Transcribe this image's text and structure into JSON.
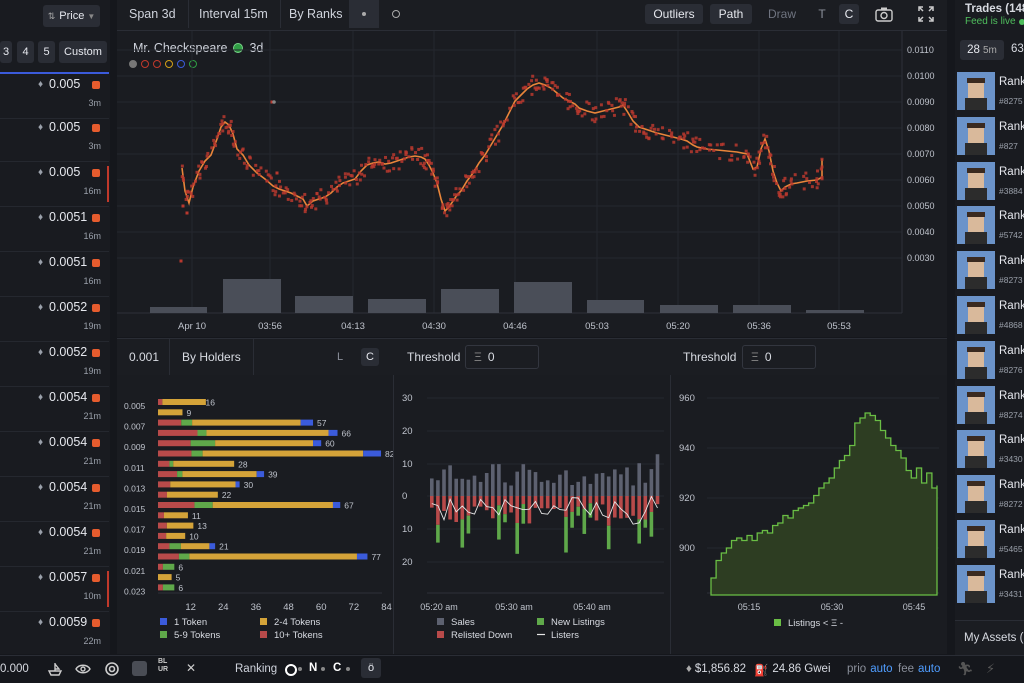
{
  "left_sidebar": {
    "sort_label": "Price",
    "qty_buttons": [
      "3",
      "4",
      "5",
      "Custom"
    ],
    "listings": [
      {
        "price": "0.005",
        "time": "3m",
        "marker": false
      },
      {
        "price": "0.005",
        "time": "3m",
        "marker": false
      },
      {
        "price": "0.005",
        "time": "16m",
        "marker": true
      },
      {
        "price": "0.0051",
        "time": "16m",
        "marker": false
      },
      {
        "price": "0.0051",
        "time": "16m",
        "marker": false
      },
      {
        "price": "0.0052",
        "time": "19m",
        "marker": false
      },
      {
        "price": "0.0052",
        "time": "19m",
        "marker": false
      },
      {
        "price": "0.0054",
        "time": "21m",
        "marker": false
      },
      {
        "price": "0.0054",
        "time": "21m",
        "marker": false
      },
      {
        "price": "0.0054",
        "time": "21m",
        "marker": false
      },
      {
        "price": "0.0054",
        "time": "21m",
        "marker": false
      },
      {
        "price": "0.0057",
        "time": "10m",
        "marker": true
      },
      {
        "price": "0.0059",
        "time": "22m",
        "marker": false
      }
    ]
  },
  "toolbar": {
    "span": "Span 3d",
    "interval": "Interval 15m",
    "by_ranks": "By Ranks",
    "outliers": "Outliers",
    "path": "Path",
    "draw": "Draw",
    "t": "T",
    "c": "C"
  },
  "main_chart": {
    "collection": "Mr. Checkspeare",
    "span_tag": "3d",
    "x_ticks": [
      "Apr 10",
      "03:56",
      "04:13",
      "04:30",
      "04:46",
      "05:03",
      "05:20",
      "05:36",
      "05:53"
    ],
    "y_ticks": [
      "0.0110",
      "0.0100",
      "0.0090",
      "0.0080",
      "0.0070",
      "0.0060",
      "0.0050",
      "0.0040",
      "0.0030"
    ],
    "legend_dot_colors": [
      "#777777",
      "#c0392b",
      "#c0392b",
      "#d4a017",
      "#3b5bdb",
      "#2f9e44"
    ]
  },
  "holders_panel": {
    "value": "0.001",
    "label": "By Holders",
    "l_btn": "L",
    "c_btn": "C",
    "chart_data": {
      "type": "bar",
      "orientation": "horizontal",
      "y_ticks": [
        "0.005",
        "0.007",
        "0.009",
        "0.011",
        "0.013",
        "0.015",
        "0.017",
        "0.019",
        "0.021",
        "0.023"
      ],
      "x_ticks": [
        "12",
        "24",
        "36",
        "48",
        "60",
        "72",
        "84"
      ],
      "rows": [
        {
          "price": 0.005,
          "total": 16
        },
        {
          "price": 0.006,
          "total": 9
        },
        {
          "price": 0.007,
          "total": 57
        },
        {
          "price": 0.008,
          "total": 66
        },
        {
          "price": 0.009,
          "total": 60
        },
        {
          "price": 0.01,
          "total": 82
        },
        {
          "price": 0.011,
          "total": 28
        },
        {
          "price": 0.012,
          "total": 39
        },
        {
          "price": 0.013,
          "total": 30
        },
        {
          "price": 0.014,
          "total": 22
        },
        {
          "price": 0.015,
          "total": 67
        },
        {
          "price": 0.016,
          "total": 11
        },
        {
          "price": 0.017,
          "total": 13
        },
        {
          "price": 0.018,
          "total": 10
        },
        {
          "price": 0.019,
          "total": 21
        },
        {
          "price": 0.02,
          "total": 77
        },
        {
          "price": 0.021,
          "total": 6
        },
        {
          "price": 0.022,
          "total": 5
        },
        {
          "price": 0.023,
          "total": 6
        }
      ],
      "legend": [
        "1 Token",
        "2-4 Tokens",
        "5-9 Tokens",
        "10+ Tokens"
      ],
      "colors": {
        "1 Token": "#3b5bdb",
        "2-4 Tokens": "#d4a339",
        "5-9 Tokens": "#5fa84a",
        "10+ Tokens": "#b84a4a"
      }
    }
  },
  "sales_panel": {
    "threshold_label": "Threshold",
    "threshold_value": "0",
    "chart_data": {
      "type": "bar",
      "y_ticks": [
        "30",
        "20",
        "10",
        "0",
        "10",
        "20"
      ],
      "x_ticks": [
        "05:20 am",
        "05:30 am",
        "05:40 am"
      ],
      "legend": [
        "Sales",
        "Relisted Down",
        "New Listings",
        "Listers"
      ],
      "colors": {
        "Sales": "#5d6170",
        "Relisted Down": "#b84a4a",
        "New Listings": "#5fa84a",
        "Listers": "#e0e0e0"
      }
    }
  },
  "listings_panel": {
    "threshold_label": "Threshold",
    "threshold_value": "0",
    "chart_data": {
      "type": "area",
      "y_ticks": [
        "960",
        "940",
        "920",
        "900"
      ],
      "x_ticks": [
        "05:15",
        "05:30",
        "05:45"
      ],
      "values": [
        888,
        895,
        898,
        900,
        903,
        904,
        903,
        905,
        903,
        906,
        907,
        906,
        909,
        910,
        913,
        912,
        915,
        916,
        917,
        918,
        921,
        924,
        926,
        928,
        932,
        935,
        937,
        941,
        950,
        952,
        954,
        953,
        951,
        947,
        944,
        941,
        939,
        936,
        931,
        928,
        932,
        926,
        930,
        924,
        925
      ],
      "legend": [
        "Listings < Ξ -"
      ],
      "colors": {
        "Listings": "#6abe45"
      }
    }
  },
  "right_sidebar": {
    "title": "Trades (148",
    "feed_status": "Feed is live",
    "time_tab": "28",
    "time_unit": "5m",
    "time_tab2": "63",
    "rank_label": "Rank",
    "trades": [
      "#8275",
      "#827",
      "#3884",
      "#5742",
      "#8273",
      "#4868",
      "#8276",
      "#8274",
      "#3430",
      "#8272",
      "#5465",
      "#3431"
    ],
    "my_assets": "My Assets ("
  },
  "status_bar": {
    "left_value": "0.000",
    "ranking_label": "Ranking",
    "n_label": "N",
    "c_label": "C",
    "eth_price": "$1,856.82",
    "gas": "24.86 Gwei",
    "prio_label": "prio",
    "prio_value": "auto",
    "fee_label": "fee",
    "fee_value": "auto"
  }
}
